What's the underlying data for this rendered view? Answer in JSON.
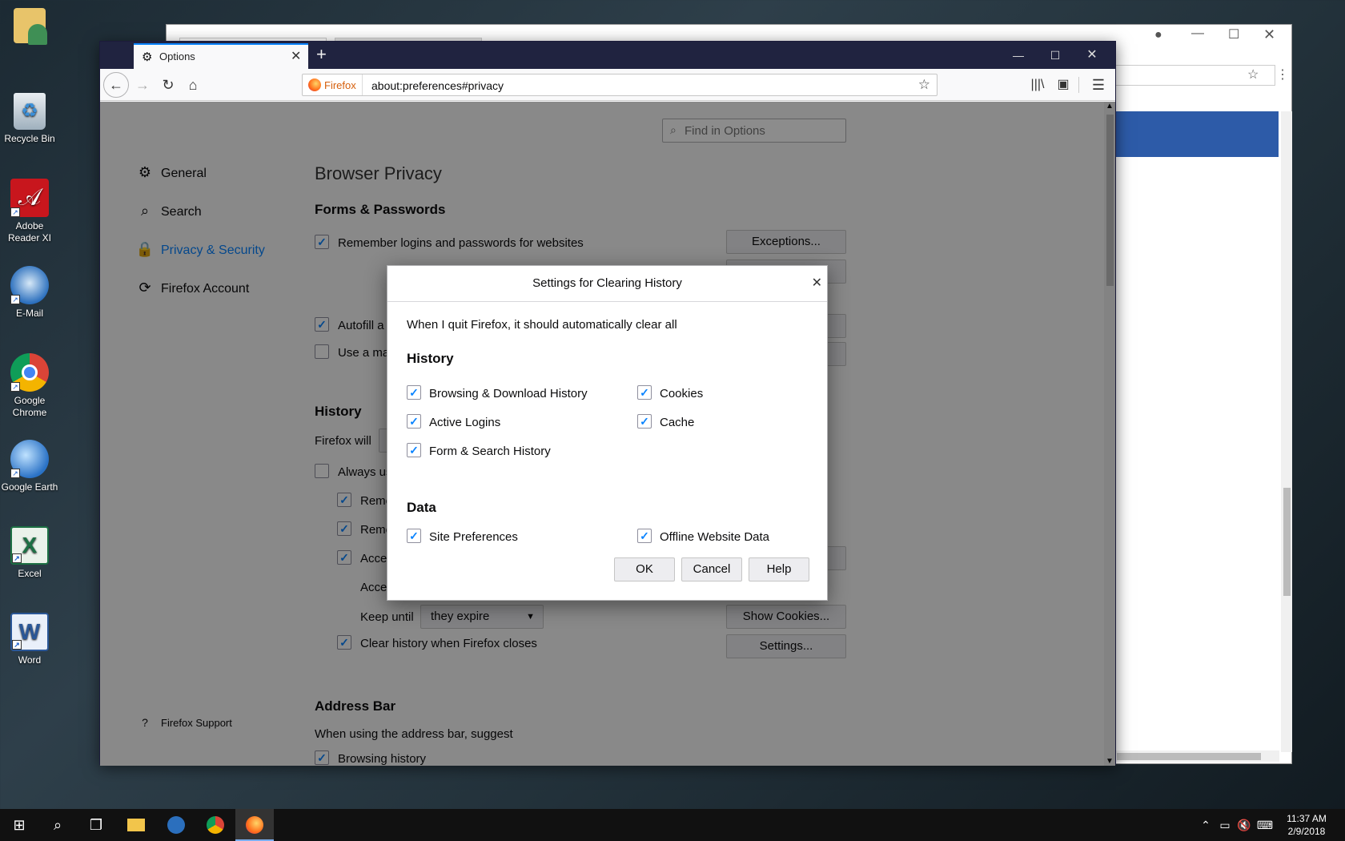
{
  "desktop": {
    "icons": [
      {
        "label": ""
      },
      {
        "label": "Recycle Bin"
      },
      {
        "label": "Adobe Reader XI"
      },
      {
        "label": "E-Mail"
      },
      {
        "label": "Google Chrome"
      },
      {
        "label": "Google Earth"
      },
      {
        "label": "Excel"
      },
      {
        "label": "Word"
      }
    ]
  },
  "browser": {
    "tab_title": "Options",
    "identity_label": "Firefox",
    "url": "about:preferences#privacy"
  },
  "prefs": {
    "search_placeholder": "Find in Options",
    "categories": [
      {
        "label": "General"
      },
      {
        "label": "Search"
      },
      {
        "label": "Privacy & Security"
      },
      {
        "label": "Firefox Account"
      }
    ],
    "support_link": "Firefox Support",
    "page_title": "Browser Privacy",
    "forms_heading": "Forms & Passwords",
    "remember_logins": "Remember logins and passwords for websites",
    "exceptions_button": "Exceptions...",
    "autofill_label": "Autofill a",
    "master_password_label": "Use a mas",
    "history_heading": "History",
    "firefox_will": "Firefox will",
    "always_use": "Always us",
    "remember_1": "Reme",
    "remember_2": "Reme",
    "accept_1": "Accep",
    "accept_2": "Accep",
    "keep_until_label": "Keep until",
    "keep_until_value": "they expire",
    "show_cookies_button": "Show Cookies...",
    "clear_history_label": "Clear history when Firefox closes",
    "settings_button": "Settings...",
    "address_bar_heading": "Address Bar",
    "address_bar_desc": "When using the address bar, suggest",
    "browsing_history": "Browsing history"
  },
  "dialog": {
    "title": "Settings for Clearing History",
    "intro": "When I quit Firefox, it should automatically clear all",
    "history_heading": "History",
    "history_items": [
      {
        "label": "Browsing & Download History",
        "checked": true
      },
      {
        "label": "Cookies",
        "checked": true
      },
      {
        "label": "Active Logins",
        "checked": true
      },
      {
        "label": "Cache",
        "checked": true
      },
      {
        "label": "Form & Search History",
        "checked": true
      }
    ],
    "data_heading": "Data",
    "data_items": [
      {
        "label": "Site Preferences",
        "checked": true
      },
      {
        "label": "Offline Website Data",
        "checked": true
      }
    ],
    "ok": "OK",
    "cancel": "Cancel",
    "help": "Help"
  },
  "taskbar": {
    "time": "11:37 AM",
    "date": "2/9/2018"
  }
}
